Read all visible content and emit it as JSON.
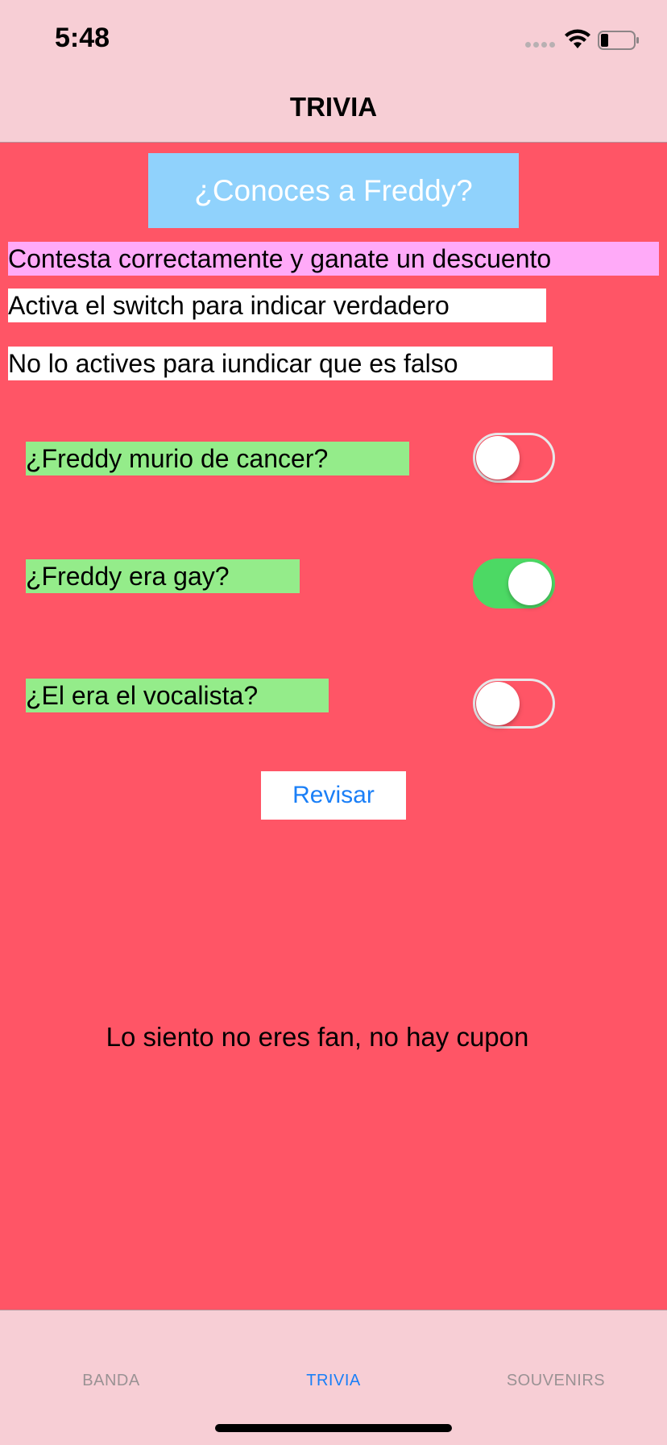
{
  "status_bar": {
    "time": "5:48",
    "icons": [
      "signal-icon",
      "wifi-icon",
      "battery-icon"
    ]
  },
  "nav": {
    "title": "TRIVIA"
  },
  "content": {
    "title_banner": "¿Conoces a Freddy?",
    "subtitle": "Contesta correctamente y ganate un descuento",
    "instruction_true": "Activa el switch para indicar verdadero",
    "instruction_false": "No lo actives para iundicar que es falso",
    "questions": [
      {
        "text": "¿Freddy murio de cancer?",
        "switch_on": false
      },
      {
        "text": "¿Freddy era gay?",
        "switch_on": true
      },
      {
        "text": "¿El era el vocalista?",
        "switch_on": false
      }
    ],
    "review_button": "Revisar",
    "result_text": "Lo siento no eres fan, no hay cupon"
  },
  "tab_bar": {
    "tabs": [
      {
        "label": "BANDA",
        "active": false
      },
      {
        "label": "TRIVIA",
        "active": true
      },
      {
        "label": "SOUVENIRS",
        "active": false
      }
    ]
  },
  "colors": {
    "background": "#ff5566",
    "bars": "#f7ced5",
    "title_banner": "#90d2fc",
    "subtitle_bg": "#ffaaf8",
    "question_bg": "#94ec8a",
    "switch_on": "#4cd964",
    "accent": "#1a7ff7"
  }
}
